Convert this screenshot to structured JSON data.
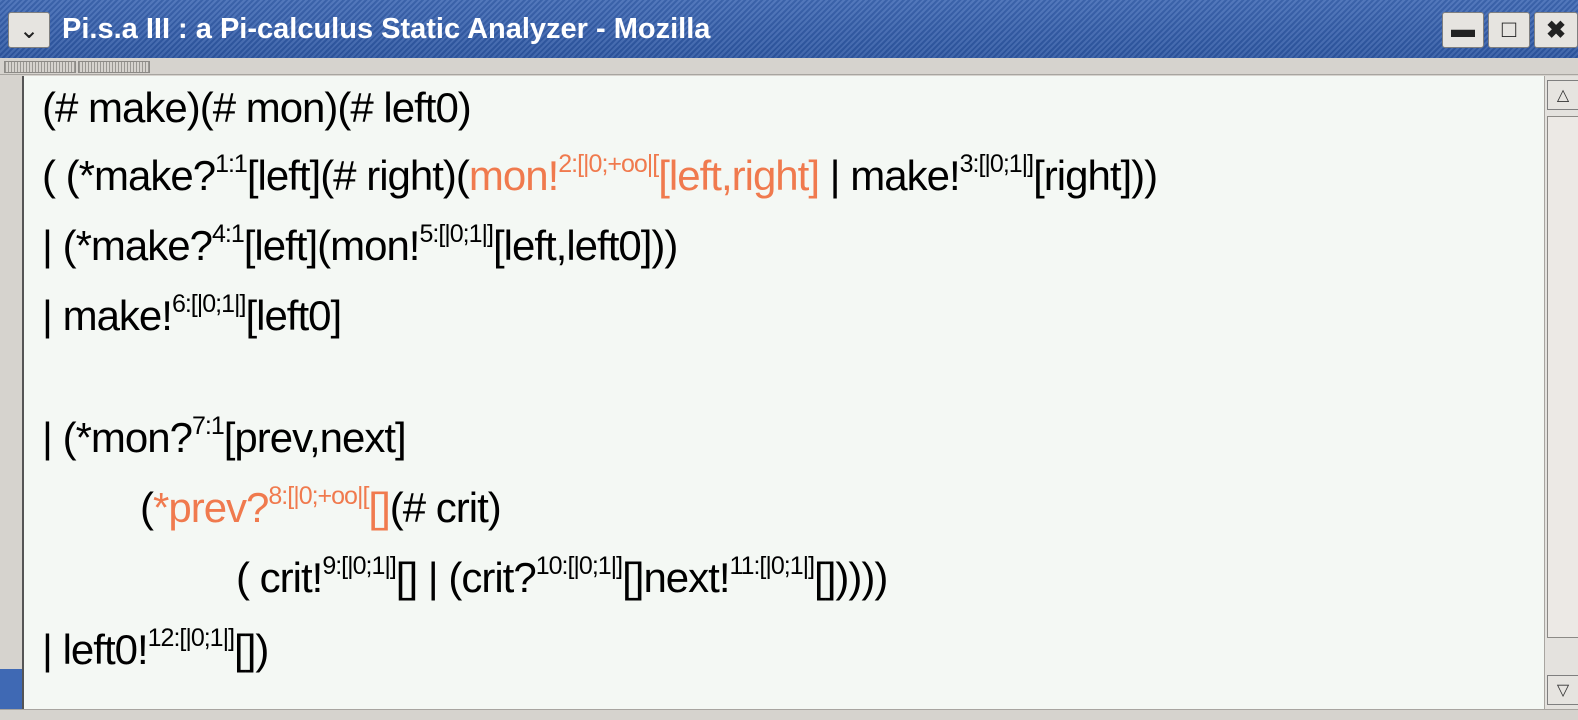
{
  "window": {
    "title": "Pi.s.a III : a Pi-calculus Static Analyzer - Mozilla",
    "menu_icon": "chevron-down-icon",
    "min_icon": "minimize-icon",
    "max_icon": "maximize-icon",
    "close_icon": "close-icon"
  },
  "program": {
    "l1": {
      "text": "(# make)(# mon)(# left0)"
    },
    "l2": {
      "a": "( (*make?",
      "a_sup": "1:1",
      "b": "[left](# right)(",
      "hl1": "mon!",
      "hl1_sup": "2:[|0;+oo|[",
      "hl2": "[left,right]",
      "c": " | make!",
      "c_sup": "3:[|0;1|]",
      "d": "[right]))"
    },
    "l3": {
      "a": "| (*make?",
      "a_sup": "4:1",
      "b": "[left](mon!",
      "b_sup": "5:[|0;1|]",
      "c": "[left,left0]))"
    },
    "l4": {
      "a": "| make!",
      "a_sup": "6:[|0;1|]",
      "b": "[left0]"
    },
    "l5": {
      "a": "| (*mon?",
      "a_sup": "7:1",
      "b": "[prev,next]"
    },
    "l6": {
      "a": "(",
      "hl1": "*prev?",
      "hl1_sup": "8:[|0;+oo|[",
      "hl2": "[]",
      "b": "(# crit)"
    },
    "l7": {
      "a": "( crit!",
      "a_sup": "9:[|0;1|]",
      "b": "[] | (crit?",
      "b_sup": "10:[|0;1|]",
      "c": "[]next!",
      "c_sup": "11:[|0;1|]",
      "d": "[]))))"
    },
    "l8": {
      "a": "| left0!",
      "a_sup": "12:[|0;1|]",
      "b": "[])"
    }
  },
  "colors": {
    "highlight": "#f07a4e",
    "titlebar": "#3f69b4"
  }
}
